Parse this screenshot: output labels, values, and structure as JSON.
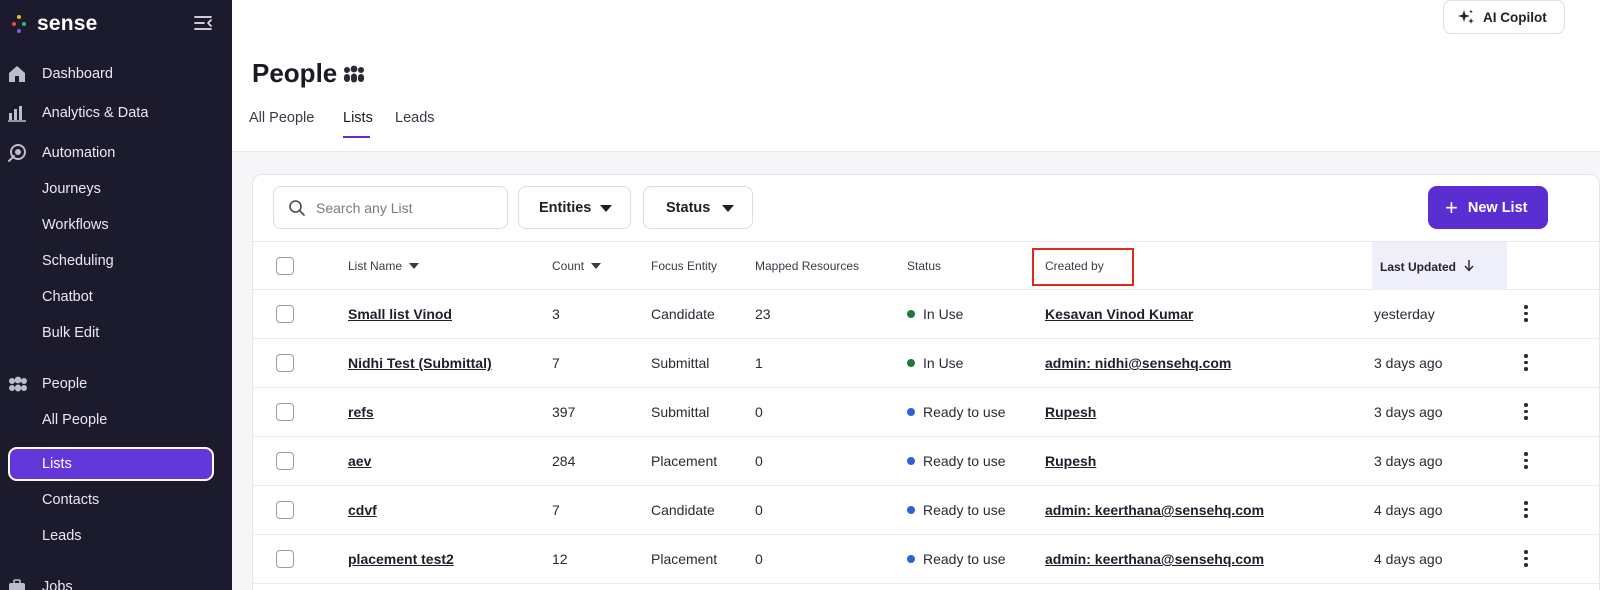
{
  "brand": {
    "name": "sense"
  },
  "sidebar": {
    "items": [
      {
        "label": "Dashboard",
        "icon": "home-icon",
        "type": "section"
      },
      {
        "label": "Analytics & Data",
        "icon": "bar-chart-icon",
        "type": "section"
      },
      {
        "label": "Automation",
        "icon": "automation-icon",
        "type": "section"
      },
      {
        "label": "Journeys",
        "type": "sub"
      },
      {
        "label": "Workflows",
        "type": "sub"
      },
      {
        "label": "Scheduling",
        "type": "sub"
      },
      {
        "label": "Chatbot",
        "type": "sub"
      },
      {
        "label": "Bulk Edit",
        "type": "sub"
      },
      {
        "label": "People",
        "icon": "people-icon",
        "type": "section"
      },
      {
        "label": "All People",
        "type": "sub"
      },
      {
        "label": "Lists",
        "type": "sub",
        "active": true
      },
      {
        "label": "Contacts",
        "type": "sub"
      },
      {
        "label": "Leads",
        "type": "sub"
      },
      {
        "label": "Jobs",
        "icon": "briefcase-icon",
        "type": "section"
      }
    ]
  },
  "header": {
    "copilot_label": "AI Copilot",
    "title": "People",
    "tabs": [
      {
        "label": "All People"
      },
      {
        "label": "Lists",
        "active": true
      },
      {
        "label": "Leads"
      }
    ]
  },
  "toolbar": {
    "search_placeholder": "Search any List",
    "entities_label": "Entities",
    "status_label": "Status",
    "new_list_label": "New List"
  },
  "table": {
    "columns": {
      "list_name": "List Name",
      "count": "Count",
      "focus_entity": "Focus Entity",
      "mapped_resources": "Mapped Resources",
      "status": "Status",
      "created_by": "Created by",
      "last_updated": "Last Updated"
    },
    "rows": [
      {
        "name": "Small list Vinod",
        "count": "3",
        "entity": "Candidate",
        "mapped": "23",
        "status": "In Use",
        "created_by": "Kesavan Vinod Kumar",
        "updated": "yesterday"
      },
      {
        "name": "Nidhi Test (Submittal)",
        "count": "7",
        "entity": "Submittal",
        "mapped": "1",
        "status": "In Use",
        "created_by": "admin: nidhi@sensehq.com",
        "updated": "3 days ago"
      },
      {
        "name": "refs",
        "count": "397",
        "entity": "Submittal",
        "mapped": "0",
        "status": "Ready to use",
        "created_by": "Rupesh",
        "updated": "3 days ago"
      },
      {
        "name": "aev",
        "count": "284",
        "entity": "Placement",
        "mapped": "0",
        "status": "Ready to use",
        "created_by": "Rupesh",
        "updated": "3 days ago"
      },
      {
        "name": "cdvf",
        "count": "7",
        "entity": "Candidate",
        "mapped": "0",
        "status": "Ready to use",
        "created_by": "admin: keerthana@sensehq.com",
        "updated": "4 days ago"
      },
      {
        "name": "placement test2",
        "count": "12",
        "entity": "Placement",
        "mapped": "0",
        "status": "Ready to use",
        "created_by": "admin: keerthana@sensehq.com",
        "updated": "4 days ago"
      }
    ]
  },
  "colors": {
    "sidebar_bg": "#1c1b2e",
    "accent": "#5a2ed1",
    "status_in_use": "#1d7a3a",
    "status_ready": "#2b62d9",
    "highlight_box": "#e0291d"
  }
}
